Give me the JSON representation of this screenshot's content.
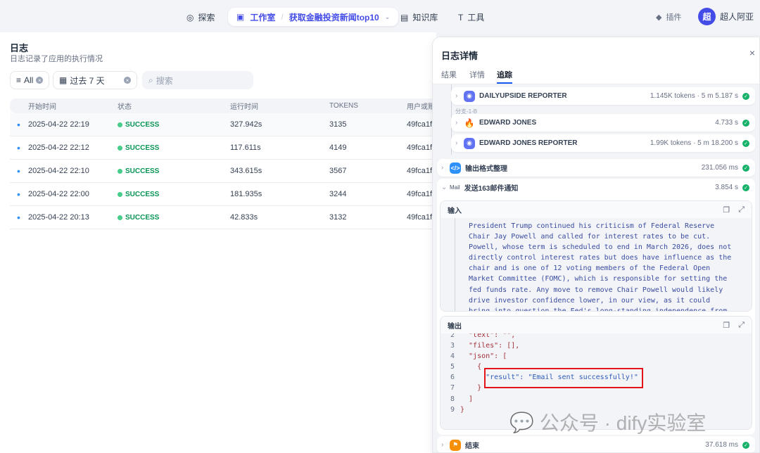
{
  "nav": {
    "explore": "探索",
    "studio": "工作室",
    "app_name": "获取金融投资新闻top10",
    "knowledge": "知识库",
    "tools": "工具",
    "plugins": "插件",
    "user_initial": "超",
    "user_name": "超人阿亚"
  },
  "logs": {
    "title": "日志",
    "subtitle": "日志记录了应用的执行情况",
    "filter_all": "All",
    "period": "过去 7 天",
    "search_placeholder": "搜索",
    "columns": [
      "开始时间",
      "状态",
      "运行时间",
      "TOKENS",
      "用户或账户"
    ],
    "rows": [
      {
        "time": "2025-04-22 22:19",
        "status": "SUCCESS",
        "runtime": "327.942s",
        "tokens": "3135",
        "user": "49fca1f"
      },
      {
        "time": "2025-04-22 22:12",
        "status": "SUCCESS",
        "runtime": "117.611s",
        "tokens": "4149",
        "user": "49fca1f"
      },
      {
        "time": "2025-04-22 22:10",
        "status": "SUCCESS",
        "runtime": "343.615s",
        "tokens": "3567",
        "user": "49fca1f"
      },
      {
        "time": "2025-04-22 22:00",
        "status": "SUCCESS",
        "runtime": "181.935s",
        "tokens": "3244",
        "user": "49fca1f"
      },
      {
        "time": "2025-04-22 20:13",
        "status": "SUCCESS",
        "runtime": "42.833s",
        "tokens": "3132",
        "user": "49fca1f"
      }
    ]
  },
  "detail": {
    "title": "日志详情",
    "tabs": [
      "结果",
      "详情",
      "追踪"
    ],
    "active_tab": "追踪",
    "branch_label": "分支-1-B",
    "nodes": [
      {
        "name": "DAILYUPSIDE REPORTER",
        "meta": "1.145K tokens · 5 m 5.187 s"
      },
      {
        "name": "EDWARD JONES",
        "meta": "4.733 s"
      },
      {
        "name": "EDWARD JONES REPORTER",
        "meta": "1.99K tokens · 5 m 18.200 s"
      },
      {
        "name": "输出格式整理",
        "meta": "231.056 ms"
      },
      {
        "name": "发送163邮件通知",
        "meta": "3.854 s",
        "icon_label": "Mail"
      },
      {
        "name": "结束",
        "meta": "37.618 ms"
      }
    ],
    "input_label": "输入",
    "output_label": "输出",
    "input_lines": [
      "President Trump continued his criticism of Federal Reserve",
      "Chair Jay Powell and called for interest rates to be cut.",
      "Powell, whose term is scheduled to end in March 2026, does not",
      "directly control interest rates but does have influence as the",
      "chair and is one of 12 voting members of the Federal Open",
      "Market Committee (FOMC), which is responsible for setting the",
      "fed funds rate. Any move to remove Chair Powell would likely",
      "drive investor confidence lower, in our view, as it could",
      "bring into question the Fed's long-standing independence from"
    ],
    "output_lines": [
      {
        "n": "2",
        "code": "  \"text\": \"\","
      },
      {
        "n": "3",
        "code": "  \"files\": [],"
      },
      {
        "n": "4",
        "code": "  \"json\": ["
      },
      {
        "n": "5",
        "code": "    {"
      },
      {
        "n": "6",
        "code": "      \"result\": \"Email sent successfully!\""
      },
      {
        "n": "7",
        "code": "    }"
      },
      {
        "n": "8",
        "code": "  ]"
      },
      {
        "n": "9",
        "code": "}"
      }
    ]
  },
  "watermark": "公众号 · dify实验室"
}
